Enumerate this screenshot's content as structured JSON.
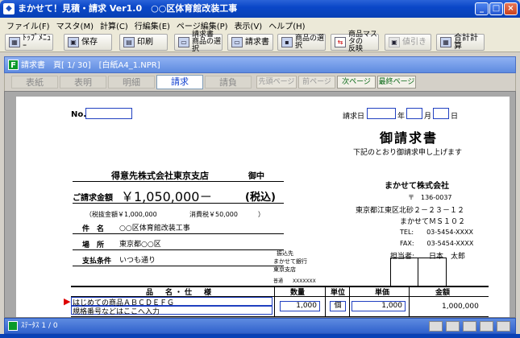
{
  "window": {
    "title": "まかせて！見積・請求 Ver1.0　○○区体育館改装工事",
    "minimize": "_",
    "maximize": "□",
    "close": "×"
  },
  "menu": [
    "ファイル(F)",
    "マスタ(M)",
    "計算(C)",
    "行編集(E)",
    "ページ編集(P)",
    "表示(V)",
    "ヘルプ(H)"
  ],
  "toolbar": {
    "top_menu": "ﾄｯﾌﾟﾒﾆｭｰ",
    "save": "保存",
    "print": "印刷",
    "invoice_select_1": "請求書",
    "invoice_select_2": "商品の選択",
    "invoice": "請求書",
    "product_select": "商品の選択",
    "master_reflect_1": "商品マスタの",
    "master_reflect_2": "反映",
    "discount": "値引き",
    "total_calc": "合計計算"
  },
  "doc": {
    "caption": "請求書　頁[ 1/ 30]　[白紙A4_1.NPR]",
    "icon_letter": "F"
  },
  "tabs": [
    "表紙",
    "表明",
    "明細",
    "請求",
    "請負"
  ],
  "page_buttons": {
    "first": "先頭ページ",
    "prev": "前ページ",
    "next": "次ページ",
    "last": "最終ページ"
  },
  "paper": {
    "no_label": "No.",
    "invoice_date_label": "請求日",
    "year": "年",
    "month": "月",
    "day": "日",
    "title": "御請求書",
    "subtitle": "下記のとおり御請求申し上げます",
    "customer": "得意先株式会社東京支店",
    "onchu": "御中",
    "amount_label": "ご請求金額",
    "amount_value": "￥1,050,000－",
    "tax_included": "(税込)",
    "tax_breakdown_open": "（税抜金額￥1,000,000",
    "tax_breakdown_tax": "消費税￥50,000",
    "tax_breakdown_close": "）",
    "subject_label": "件　名",
    "subject_value": "○○区体育館改装工事",
    "location_label": "場　所",
    "location_value": "東京都○○区",
    "payment_label": "支払条件",
    "payment_value": "いつも通り",
    "company_name": "まかせて株式会社",
    "postal": "〒　136-0037",
    "address": "東京都江東区北砂２－２３－１２",
    "building": "まかせてＭＳ１０２",
    "tel": "TEL:　　03-5454-XXXX",
    "fax": "FAX:　　03-5454-XXXX",
    "person_label": "担当者:",
    "person_value": "日本　太郎",
    "bank_label": "振込先",
    "bank_name": "まかせて銀行",
    "bank_branch": "東京支店",
    "bank_account": "普通　　XXXXXXX",
    "col_item": "品　名・仕　様",
    "col_qty": "数量",
    "col_unit": "単位",
    "col_price": "単価",
    "col_amount": "金額",
    "row1_name": "はじめての商品ＡＢＣＤＥＦＧ",
    "row1_spec": "規格番号などはここへ入力",
    "row1_qty": "1,000",
    "row1_unit": "個",
    "row1_price": "1,000",
    "row1_amount": "1,000,000"
  },
  "status": {
    "text": "ｽﾃｰﾀｽ 1 / 0"
  }
}
